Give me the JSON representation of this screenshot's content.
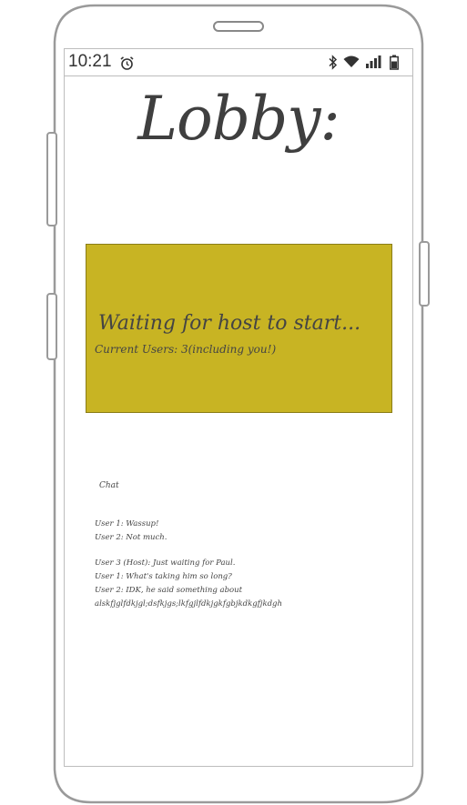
{
  "status_bar": {
    "time": "10:21",
    "icons": [
      "alarm-icon",
      "bluetooth-icon",
      "wifi-icon",
      "signal-icon",
      "battery-icon"
    ]
  },
  "lobby": {
    "title": "Lobby:"
  },
  "waiting_panel": {
    "title": "Waiting for host to start...",
    "users_text": "Current Users: 3(including you!)",
    "background_color": "#c8b423"
  },
  "chat": {
    "label": "Chat",
    "messages": [
      "User 1: Wassup!",
      "User 2: Not much.",
      "User 3 (Host): Just waiting for Paul.",
      "User 1: What's taking him so long?",
      "User 2: IDK, he said something about",
      "alskfjglfdkjgl;dsfkjgs;lkfgjlfdkjgkfgbjkdkgfjkdgh"
    ]
  }
}
